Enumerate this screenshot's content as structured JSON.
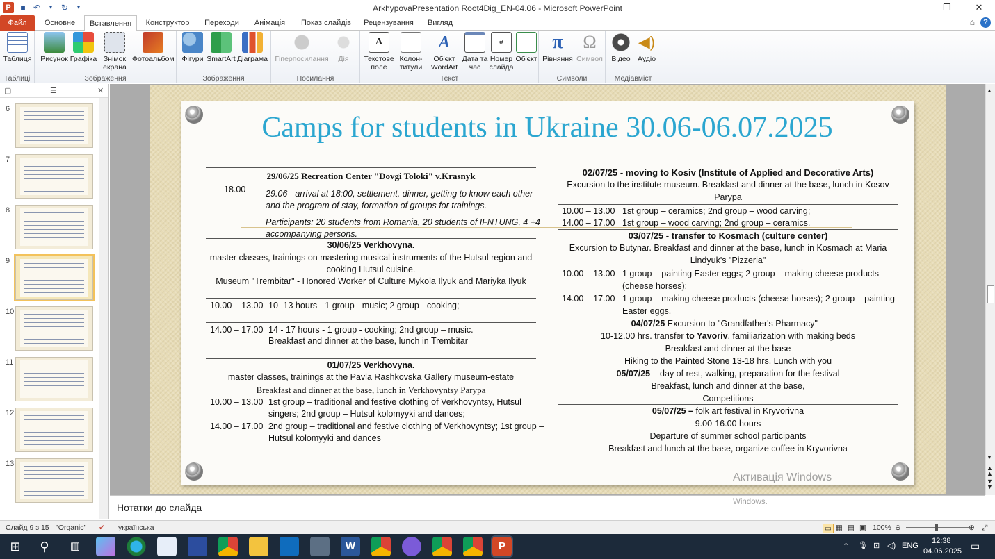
{
  "window": {
    "title": "ArkhypovaPresentation Root4Dig_EN-04.06  -  Microsoft PowerPoint"
  },
  "tabs": [
    "Файл",
    "Основне",
    "Вставлення",
    "Конструктор",
    "Переходи",
    "Анімація",
    "Показ слайдів",
    "Рецензування",
    "Вигляд"
  ],
  "ribbon": {
    "tables": {
      "label": "Таблиця",
      "group": "Таблиці"
    },
    "images": {
      "picture": "Рисунок",
      "clipart": "Графіка",
      "screenshot": "Знімок екрана",
      "album": "Фотоальбом",
      "group": "Зображення"
    },
    "illustrations": {
      "shapes": "Фігури",
      "smartart": "SmartArt",
      "chart": "Діаграма",
      "group": "Зображення"
    },
    "links": {
      "hyperlink": "Гіперпосилання",
      "action": "Дія",
      "group": "Посилання"
    },
    "text": {
      "textbox": "Текстове поле",
      "header": "Колон-титули",
      "wordart": "Об'єкт WordArt",
      "datetime": "Дата та час",
      "slidenum": "Номер слайда",
      "object": "Об'єкт",
      "group": "Текст"
    },
    "symbols": {
      "equation": "Рівняння",
      "symbol": "Символ",
      "group": "Символи"
    },
    "media": {
      "video": "Відео",
      "audio": "Аудіо",
      "group": "Медіавміст"
    }
  },
  "thumbnails": [
    {
      "num": "6"
    },
    {
      "num": "7"
    },
    {
      "num": "8"
    },
    {
      "num": "9",
      "selected": true
    },
    {
      "num": "10"
    },
    {
      "num": "11"
    },
    {
      "num": "12"
    },
    {
      "num": "13"
    }
  ],
  "slide": {
    "title": "Camps for students in Ukraine 30.06-06.07.2025",
    "left": {
      "d1_head": "29/06/25 Recreation Center \"Dovgi Toloki\" v.Krasnyk",
      "d1_time": "18.00",
      "d1_l1": "29.06 - arrival at 18:00, settlement, dinner, getting to know each other",
      "d1_l2": "and the program of stay, formation of groups for trainings.",
      "d1_l3": "Participants: 20 students from Romania, 20 students of IFNTUNG, 4 +4",
      "d1_l4": "accompanying persons.",
      "d2_head": "30/06/25 Verkhovyna.",
      "d2_l1": "master classes, trainings on mastering musical instruments of the Hutsul region and",
      "d2_l2": "cooking Hutsul cuisine.",
      "d2_l3": "Museum \"Trembitar\" - Honored Worker of Culture Mykola Ilyuk and Mariyka Ilyuk",
      "d2_t1": "10.00 – 13.00",
      "d2_a1": "10 -13 hours - 1 group - music; 2 group - cooking;",
      "d2_t2": "14.00 – 17.00",
      "d2_a2": "14 - 17 hours - 1 group - cooking; 2nd group – music.",
      "d2_a3": "Breakfast and dinner at the base, lunch in Trembitar",
      "d3_head": "01/07/25 Verkhovyna.",
      "d3_l1": "master classes, trainings at the Pavla Rashkovska Gallery museum-estate",
      "d3_l2": "Breakfast and dinner at the base, lunch in Verkhovyntsy Parypa",
      "d3_t1": "10.00 – 13.00",
      "d3_a1": "1st group – traditional and festive clothing of Verkhovyntsy, Hutsul",
      "d3_a2": "singers; 2nd group – Hutsul kolomyyki and dances;",
      "d3_t2": "14.00 – 17.00",
      "d3_a3": "2nd group – traditional and festive clothing of Verkhovyntsy; 1st group –",
      "d3_a4": "Hutsul kolomyyki and dances"
    },
    "right": {
      "d4_head": "02/07/25 - moving to Kosiv (Institute of Applied and Decorative Arts)",
      "d4_l1": "Excursion to the institute museum. Breakfast and dinner at the base, lunch in Kosov",
      "d4_l2": "Parypa",
      "d4_t1": "10.00 – 13.00",
      "d4_a1": "1st group – ceramics; 2nd group – wood carving;",
      "d4_t2": "14.00 – 17.00",
      "d4_a2": "1st group – wood carving; 2nd group – ceramics.",
      "d5_head": "03/07/25 - transfer to Kosmach (culture center)",
      "d5_l1": "Excursion to Butynar. Breakfast and dinner at the base, lunch in Kosmach at Maria",
      "d5_l2": "Lindyuk's \"Pizzeria\"",
      "d5_t1": "10.00 – 13.00",
      "d5_a1": "1 group – painting Easter eggs; 2 group – making cheese products",
      "d5_a2": "(cheese horses);",
      "d5_t2": "14.00 – 17.00",
      "d5_a3": "1 group – making cheese products (cheese horses); 2 group – painting",
      "d5_a4": "Easter eggs.",
      "d6_date": "04/07/25",
      "d6_rest": " Excursion to \"Grandfather's Pharmacy\" –",
      "d6_l2a": "10-12.00 hrs. transfer ",
      "d6_l2b": "to Yavoriv",
      "d6_l2c": ", familiarization with making beds",
      "d6_l3": "Breakfast and dinner at the base",
      "d6_l4": "Hiking to the Painted Stone 13-18 hrs. Lunch with you",
      "d7_date": "05/07/25",
      "d7_rest": " – day of rest, walking, preparation for the festival",
      "d7_l2": "Breakfast, lunch and dinner at the base,",
      "d7_l3": "Competitions",
      "d8_date": "05/07/25 –",
      "d8_rest": " folk art festival in Kryvorivna",
      "d8_l2": "9.00-16.00 hours",
      "d8_l3": "Departure of summer school participants",
      "d8_l4": "Breakfast and lunch at the base, organize coffee in Kryvorivna"
    }
  },
  "notes": {
    "placeholder": "Нотатки до слайда"
  },
  "watermark": {
    "line1": "Активація Windows",
    "line2": "Windows."
  },
  "status": {
    "slide": "Слайд 9 з 15",
    "theme": "\"Organic\"",
    "lang": "українська",
    "zoom": "100%"
  },
  "taskbar": {
    "time": "12:38",
    "date": "04.06.2025",
    "lang": "ENG"
  }
}
